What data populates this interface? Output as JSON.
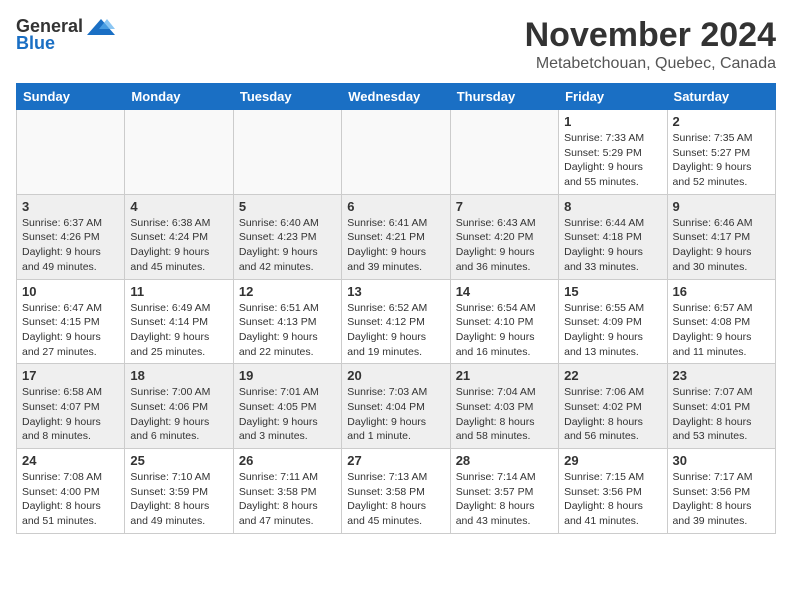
{
  "header": {
    "logo_general": "General",
    "logo_blue": "Blue",
    "month_title": "November 2024",
    "location": "Metabetchouan, Quebec, Canada"
  },
  "weekdays": [
    "Sunday",
    "Monday",
    "Tuesday",
    "Wednesday",
    "Thursday",
    "Friday",
    "Saturday"
  ],
  "weeks": [
    [
      {
        "day": "",
        "sunrise": "",
        "sunset": "",
        "daylight": ""
      },
      {
        "day": "",
        "sunrise": "",
        "sunset": "",
        "daylight": ""
      },
      {
        "day": "",
        "sunrise": "",
        "sunset": "",
        "daylight": ""
      },
      {
        "day": "",
        "sunrise": "",
        "sunset": "",
        "daylight": ""
      },
      {
        "day": "",
        "sunrise": "",
        "sunset": "",
        "daylight": ""
      },
      {
        "day": "1",
        "sunrise": "Sunrise: 7:33 AM",
        "sunset": "Sunset: 5:29 PM",
        "daylight": "Daylight: 9 hours and 55 minutes."
      },
      {
        "day": "2",
        "sunrise": "Sunrise: 7:35 AM",
        "sunset": "Sunset: 5:27 PM",
        "daylight": "Daylight: 9 hours and 52 minutes."
      }
    ],
    [
      {
        "day": "3",
        "sunrise": "Sunrise: 6:37 AM",
        "sunset": "Sunset: 4:26 PM",
        "daylight": "Daylight: 9 hours and 49 minutes."
      },
      {
        "day": "4",
        "sunrise": "Sunrise: 6:38 AM",
        "sunset": "Sunset: 4:24 PM",
        "daylight": "Daylight: 9 hours and 45 minutes."
      },
      {
        "day": "5",
        "sunrise": "Sunrise: 6:40 AM",
        "sunset": "Sunset: 4:23 PM",
        "daylight": "Daylight: 9 hours and 42 minutes."
      },
      {
        "day": "6",
        "sunrise": "Sunrise: 6:41 AM",
        "sunset": "Sunset: 4:21 PM",
        "daylight": "Daylight: 9 hours and 39 minutes."
      },
      {
        "day": "7",
        "sunrise": "Sunrise: 6:43 AM",
        "sunset": "Sunset: 4:20 PM",
        "daylight": "Daylight: 9 hours and 36 minutes."
      },
      {
        "day": "8",
        "sunrise": "Sunrise: 6:44 AM",
        "sunset": "Sunset: 4:18 PM",
        "daylight": "Daylight: 9 hours and 33 minutes."
      },
      {
        "day": "9",
        "sunrise": "Sunrise: 6:46 AM",
        "sunset": "Sunset: 4:17 PM",
        "daylight": "Daylight: 9 hours and 30 minutes."
      }
    ],
    [
      {
        "day": "10",
        "sunrise": "Sunrise: 6:47 AM",
        "sunset": "Sunset: 4:15 PM",
        "daylight": "Daylight: 9 hours and 27 minutes."
      },
      {
        "day": "11",
        "sunrise": "Sunrise: 6:49 AM",
        "sunset": "Sunset: 4:14 PM",
        "daylight": "Daylight: 9 hours and 25 minutes."
      },
      {
        "day": "12",
        "sunrise": "Sunrise: 6:51 AM",
        "sunset": "Sunset: 4:13 PM",
        "daylight": "Daylight: 9 hours and 22 minutes."
      },
      {
        "day": "13",
        "sunrise": "Sunrise: 6:52 AM",
        "sunset": "Sunset: 4:12 PM",
        "daylight": "Daylight: 9 hours and 19 minutes."
      },
      {
        "day": "14",
        "sunrise": "Sunrise: 6:54 AM",
        "sunset": "Sunset: 4:10 PM",
        "daylight": "Daylight: 9 hours and 16 minutes."
      },
      {
        "day": "15",
        "sunrise": "Sunrise: 6:55 AM",
        "sunset": "Sunset: 4:09 PM",
        "daylight": "Daylight: 9 hours and 13 minutes."
      },
      {
        "day": "16",
        "sunrise": "Sunrise: 6:57 AM",
        "sunset": "Sunset: 4:08 PM",
        "daylight": "Daylight: 9 hours and 11 minutes."
      }
    ],
    [
      {
        "day": "17",
        "sunrise": "Sunrise: 6:58 AM",
        "sunset": "Sunset: 4:07 PM",
        "daylight": "Daylight: 9 hours and 8 minutes."
      },
      {
        "day": "18",
        "sunrise": "Sunrise: 7:00 AM",
        "sunset": "Sunset: 4:06 PM",
        "daylight": "Daylight: 9 hours and 6 minutes."
      },
      {
        "day": "19",
        "sunrise": "Sunrise: 7:01 AM",
        "sunset": "Sunset: 4:05 PM",
        "daylight": "Daylight: 9 hours and 3 minutes."
      },
      {
        "day": "20",
        "sunrise": "Sunrise: 7:03 AM",
        "sunset": "Sunset: 4:04 PM",
        "daylight": "Daylight: 9 hours and 1 minute."
      },
      {
        "day": "21",
        "sunrise": "Sunrise: 7:04 AM",
        "sunset": "Sunset: 4:03 PM",
        "daylight": "Daylight: 8 hours and 58 minutes."
      },
      {
        "day": "22",
        "sunrise": "Sunrise: 7:06 AM",
        "sunset": "Sunset: 4:02 PM",
        "daylight": "Daylight: 8 hours and 56 minutes."
      },
      {
        "day": "23",
        "sunrise": "Sunrise: 7:07 AM",
        "sunset": "Sunset: 4:01 PM",
        "daylight": "Daylight: 8 hours and 53 minutes."
      }
    ],
    [
      {
        "day": "24",
        "sunrise": "Sunrise: 7:08 AM",
        "sunset": "Sunset: 4:00 PM",
        "daylight": "Daylight: 8 hours and 51 minutes."
      },
      {
        "day": "25",
        "sunrise": "Sunrise: 7:10 AM",
        "sunset": "Sunset: 3:59 PM",
        "daylight": "Daylight: 8 hours and 49 minutes."
      },
      {
        "day": "26",
        "sunrise": "Sunrise: 7:11 AM",
        "sunset": "Sunset: 3:58 PM",
        "daylight": "Daylight: 8 hours and 47 minutes."
      },
      {
        "day": "27",
        "sunrise": "Sunrise: 7:13 AM",
        "sunset": "Sunset: 3:58 PM",
        "daylight": "Daylight: 8 hours and 45 minutes."
      },
      {
        "day": "28",
        "sunrise": "Sunrise: 7:14 AM",
        "sunset": "Sunset: 3:57 PM",
        "daylight": "Daylight: 8 hours and 43 minutes."
      },
      {
        "day": "29",
        "sunrise": "Sunrise: 7:15 AM",
        "sunset": "Sunset: 3:56 PM",
        "daylight": "Daylight: 8 hours and 41 minutes."
      },
      {
        "day": "30",
        "sunrise": "Sunrise: 7:17 AM",
        "sunset": "Sunset: 3:56 PM",
        "daylight": "Daylight: 8 hours and 39 minutes."
      }
    ]
  ]
}
